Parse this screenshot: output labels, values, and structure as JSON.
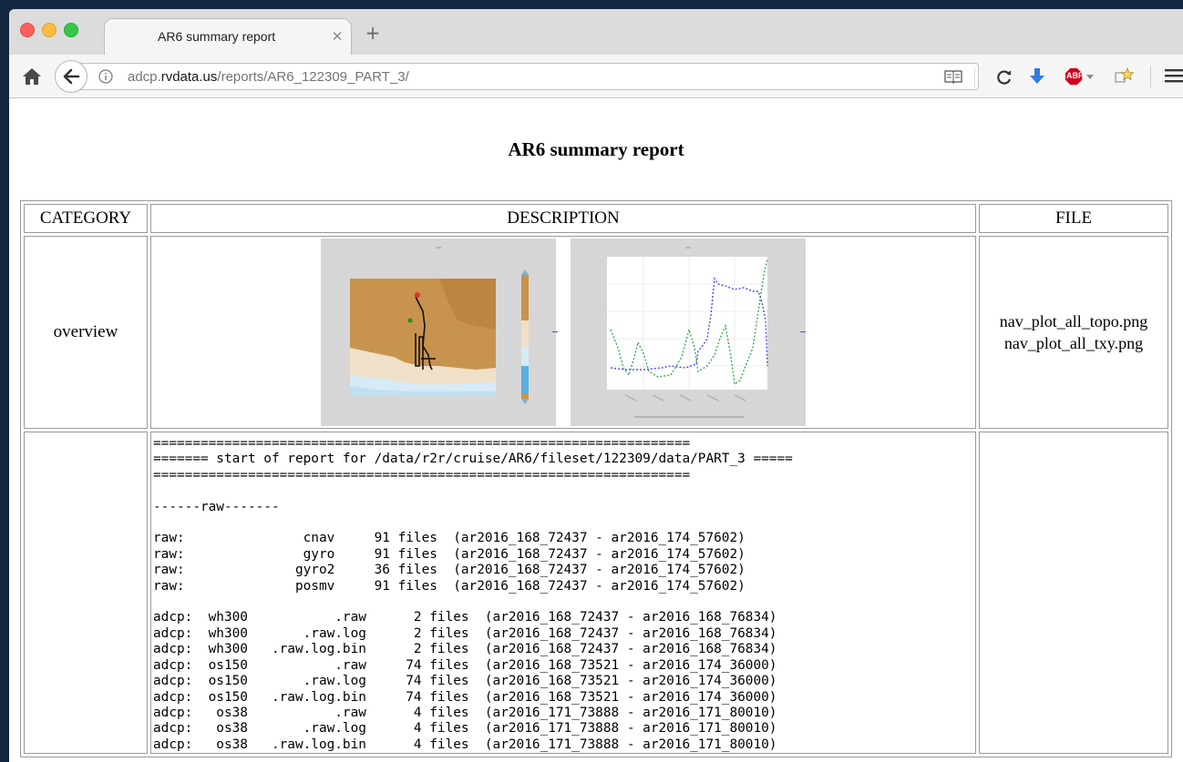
{
  "browser": {
    "tab": {
      "title": "AR6 summary report"
    },
    "url": {
      "prefix": "adcp.",
      "host": "rvdata.us",
      "path": "/reports/AR6_122309_PART_3/"
    }
  },
  "page": {
    "title": "AR6 summary report",
    "table": {
      "headers": [
        "CATEGORY",
        "DESCRIPTION",
        "FILE"
      ],
      "overview": {
        "category": "overview",
        "files": [
          "nav_plot_all_topo.png",
          "nav_plot_all_txy.png"
        ]
      },
      "report_lines": [
        "====================================================================",
        "======= start of report for /data/r2r/cruise/AR6/fileset/122309/data/PART_3 =====",
        "====================================================================",
        "",
        "------raw-------",
        "",
        "raw:               cnav     91 files  (ar2016_168_72437 - ar2016_174_57602)",
        "raw:               gyro     91 files  (ar2016_168_72437 - ar2016_174_57602)",
        "raw:              gyro2     36 files  (ar2016_168_72437 - ar2016_174_57602)",
        "raw:              posmv     91 files  (ar2016_168_72437 - ar2016_174_57602)",
        "",
        "adcp:  wh300           .raw      2 files  (ar2016_168_72437 - ar2016_168_76834)",
        "adcp:  wh300       .raw.log      2 files  (ar2016_168_72437 - ar2016_168_76834)",
        "adcp:  wh300   .raw.log.bin      2 files  (ar2016_168_72437 - ar2016_168_76834)",
        "adcp:  os150           .raw     74 files  (ar2016_168_73521 - ar2016_174_36000)",
        "adcp:  os150       .raw.log     74 files  (ar2016_168_73521 - ar2016_174_36000)",
        "adcp:  os150   .raw.log.bin     74 files  (ar2016_168_73521 - ar2016_174_36000)",
        "adcp:   os38           .raw      4 files  (ar2016_171_73888 - ar2016_171_80010)",
        "adcp:   os38       .raw.log      4 files  (ar2016_171_73888 - ar2016_171_80010)",
        "adcp:   os38   .raw.log.bin      4 files  (ar2016_171_73888 - ar2016_171_80010)"
      ]
    }
  },
  "icons": {
    "home": "home-icon",
    "back": "back-arrow-icon",
    "info": "info-icon",
    "reader": "reader-view-icon",
    "reload": "reload-icon",
    "download": "download-arrow-icon",
    "adblock": "adblock-plus-icon",
    "bookmark": "bookmark-star-icon",
    "menu": "hamburger-menu-icon"
  },
  "adblock_label": "ABP"
}
